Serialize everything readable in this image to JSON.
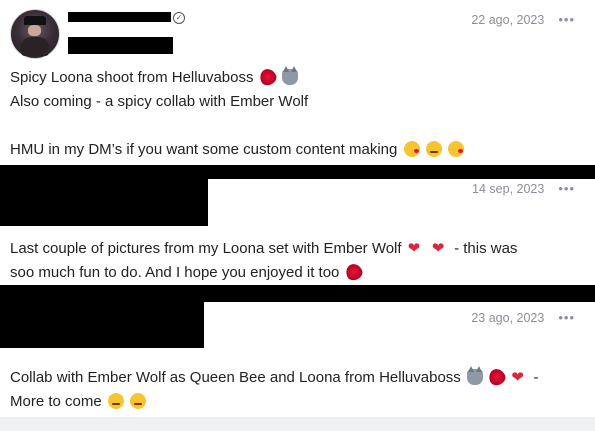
{
  "posts": [
    {
      "date": "22 ago, 2023",
      "more": "•••",
      "lines": [
        "Spicy Loona shoot from Helluvaboss",
        "Also coming - a spicy collab with Ember Wolf",
        "",
        "HMU in my DM’s if you want some custom content making"
      ],
      "icons": [
        "lips-emoji",
        "wolf-emoji",
        "kissing-face-emoji",
        "smirk-face-emoji",
        "kissing-face-emoji"
      ]
    },
    {
      "date": "14 sep, 2023",
      "more": "•••",
      "line1_a": "Last couple of pictures from my Loona set with Ember Wolf",
      "line1_b": " - this was",
      "line2": "soo much fun to do. And I hope you enjoyed it too",
      "icons": [
        "heart-emoji",
        "heart-emoji",
        "lips-emoji"
      ]
    },
    {
      "date": "23 ago, 2023",
      "more": "•••",
      "line1_a": "Collab with Ember Wolf as Queen Bee and Loona from Helluvaboss",
      "line1_b": " -",
      "line2": "More to come",
      "icons": [
        "wolf-emoji",
        "lips-emoji",
        "heart-emoji",
        "smirk-face-emoji",
        "smirk-face-emoji"
      ]
    }
  ]
}
